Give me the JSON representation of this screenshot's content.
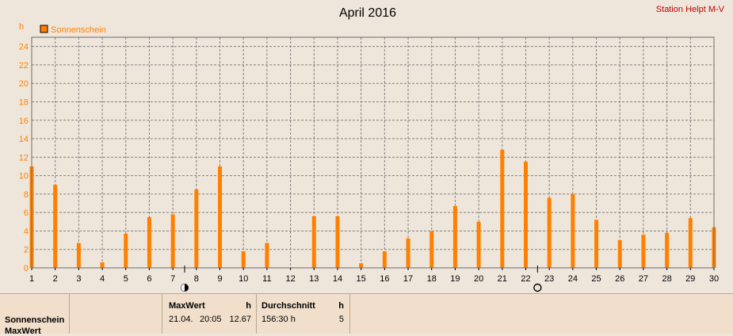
{
  "chart_data": {
    "type": "bar",
    "title": "April 2016",
    "station": "Station Helpt M-V",
    "ylabel": "h",
    "series": [
      {
        "name": "Sonnenschein",
        "color": "#ff8000",
        "values": [
          11.0,
          9.0,
          2.7,
          0.6,
          3.7,
          5.5,
          5.8,
          8.5,
          11.0,
          1.8,
          2.7,
          0,
          5.6,
          5.6,
          0.5,
          1.8,
          3.2,
          4.0,
          6.7,
          5.0,
          12.8,
          11.5,
          7.6,
          8.0,
          5.2,
          3.0,
          3.6,
          3.8,
          5.4,
          4.4
        ]
      }
    ],
    "categories": [
      "1",
      "2",
      "3",
      "4",
      "5",
      "6",
      "7",
      "8",
      "9",
      "10",
      "11",
      "12",
      "13",
      "14",
      "15",
      "16",
      "17",
      "18",
      "19",
      "20",
      "21",
      "22",
      "23",
      "24",
      "25",
      "26",
      "27",
      "28",
      "29",
      "30"
    ],
    "ylim": [
      0,
      25
    ],
    "yticks": [
      "0",
      "2",
      "4",
      "6",
      "8",
      "10",
      "12",
      "14",
      "16",
      "18",
      "20",
      "22",
      "24"
    ],
    "grid": true,
    "legend_position": "top-left",
    "colors": {
      "axis_text": "#ff8000",
      "grid": "#808080",
      "station": "#c00000"
    },
    "moon_markers": [
      {
        "day_after": 7,
        "phase": "new-moon-icon"
      },
      {
        "day_after": 22,
        "phase": "full-moon-icon"
      }
    ]
  },
  "stats": {
    "row_labels": [
      "Sonnenschein",
      "MaxWert"
    ],
    "max_header": "MaxWert",
    "max_unit": "h",
    "max_date": "21.04.",
    "max_time": "20:05",
    "max_value": "12.67",
    "avg_header": "Durchschnitt",
    "avg_unit": "h",
    "avg_value": "156:30 h",
    "avg_days": "5"
  }
}
